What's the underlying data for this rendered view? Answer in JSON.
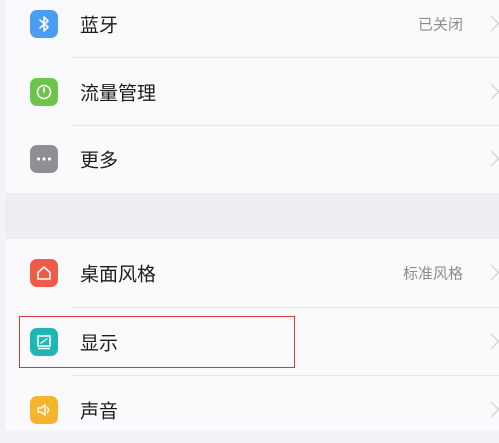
{
  "settings": {
    "items": [
      {
        "label": "蓝牙",
        "value": "已关闭",
        "icon": "bluetooth-icon",
        "color": "#4a9df2"
      },
      {
        "label": "流量管理",
        "value": "",
        "icon": "gauge-icon",
        "color": "#6cc54a"
      },
      {
        "label": "更多",
        "value": "",
        "icon": "more-icon",
        "color": "#8e8e93"
      },
      {
        "label": "桌面风格",
        "value": "标准风格",
        "icon": "home-icon",
        "color": "#ef5b47"
      },
      {
        "label": "显示",
        "value": "",
        "icon": "display-icon",
        "color": "#1fb6b5"
      },
      {
        "label": "声音",
        "value": "",
        "icon": "speaker-icon",
        "color": "#f6b42c"
      }
    ]
  }
}
